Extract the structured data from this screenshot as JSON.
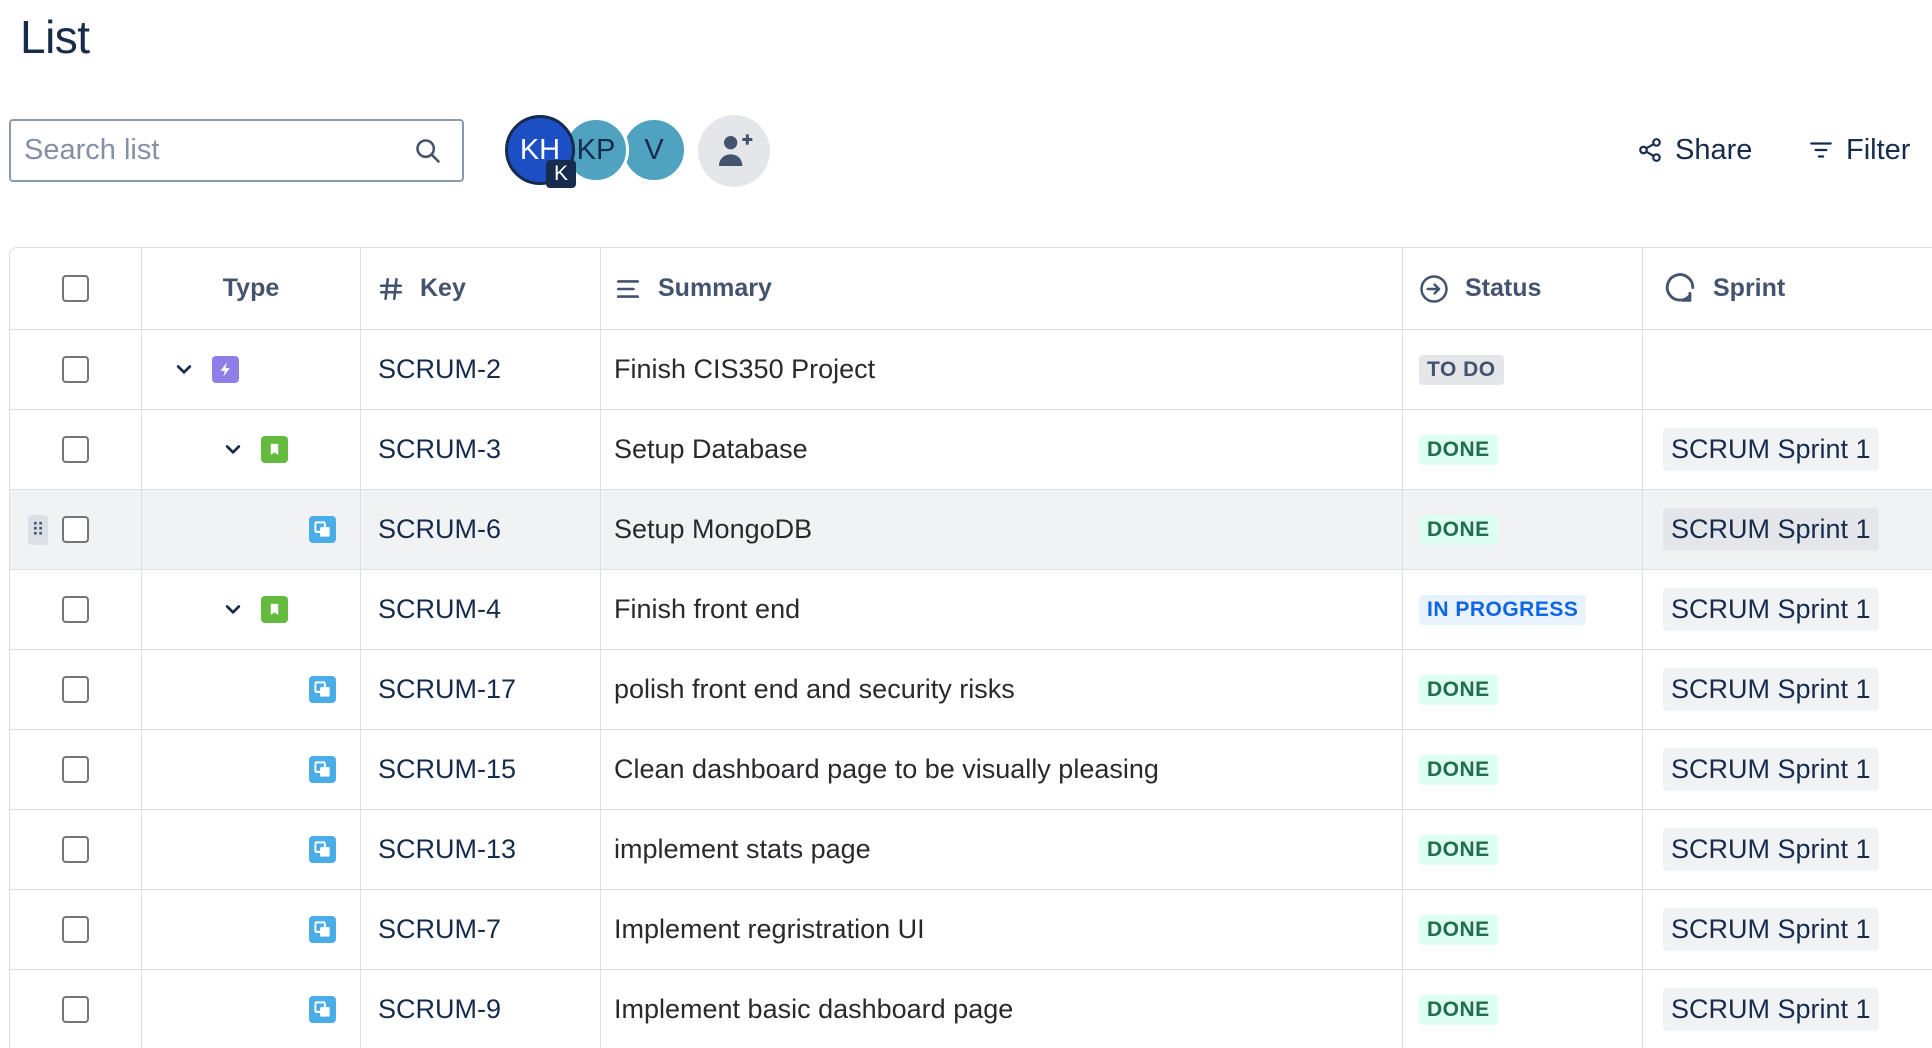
{
  "page": {
    "title": "List"
  },
  "search": {
    "placeholder": "Search list"
  },
  "avatars": [
    {
      "initials": "KH",
      "badge": "K",
      "color": "#1d4fc4"
    },
    {
      "initials": "KP",
      "color": "#4fa3c1"
    },
    {
      "initials": "V",
      "color": "#4fa3c1"
    }
  ],
  "toolbar": {
    "share_label": "Share",
    "filter_label": "Filter"
  },
  "columns": {
    "type": "Type",
    "key": "Key",
    "summary": "Summary",
    "status": "Status",
    "sprint": "Sprint"
  },
  "rows": [
    {
      "level": 0,
      "expandable": true,
      "issue_type": "epic",
      "key": "SCRUM-2",
      "summary": "Finish CIS350 Project",
      "status": "TO DO",
      "status_kind": "todo",
      "sprint": ""
    },
    {
      "level": 1,
      "expandable": true,
      "issue_type": "story",
      "key": "SCRUM-3",
      "summary": "Setup Database",
      "status": "DONE",
      "status_kind": "done",
      "sprint": "SCRUM Sprint 1"
    },
    {
      "level": 2,
      "expandable": false,
      "issue_type": "subtask",
      "key": "SCRUM-6",
      "summary": "Setup MongoDB",
      "status": "DONE",
      "status_kind": "done",
      "sprint": "SCRUM Sprint 1",
      "hovered": true
    },
    {
      "level": 1,
      "expandable": true,
      "issue_type": "story",
      "key": "SCRUM-4",
      "summary": "Finish front end",
      "status": "IN PROGRESS",
      "status_kind": "progress",
      "sprint": "SCRUM Sprint 1"
    },
    {
      "level": 2,
      "expandable": false,
      "issue_type": "subtask",
      "key": "SCRUM-17",
      "summary": "polish front end and security risks",
      "status": "DONE",
      "status_kind": "done",
      "sprint": "SCRUM Sprint 1"
    },
    {
      "level": 2,
      "expandable": false,
      "issue_type": "subtask",
      "key": "SCRUM-15",
      "summary": "Clean dashboard page to be visually pleasing",
      "status": "DONE",
      "status_kind": "done",
      "sprint": "SCRUM Sprint 1"
    },
    {
      "level": 2,
      "expandable": false,
      "issue_type": "subtask",
      "key": "SCRUM-13",
      "summary": "implement stats page",
      "status": "DONE",
      "status_kind": "done",
      "sprint": "SCRUM Sprint 1"
    },
    {
      "level": 2,
      "expandable": false,
      "issue_type": "subtask",
      "key": "SCRUM-7",
      "summary": "Implement regristration UI",
      "status": "DONE",
      "status_kind": "done",
      "sprint": "SCRUM Sprint 1"
    },
    {
      "level": 2,
      "expandable": false,
      "issue_type": "subtask",
      "key": "SCRUM-9",
      "summary": "Implement basic dashboard page",
      "status": "DONE",
      "status_kind": "done",
      "sprint": "SCRUM Sprint 1"
    }
  ]
}
